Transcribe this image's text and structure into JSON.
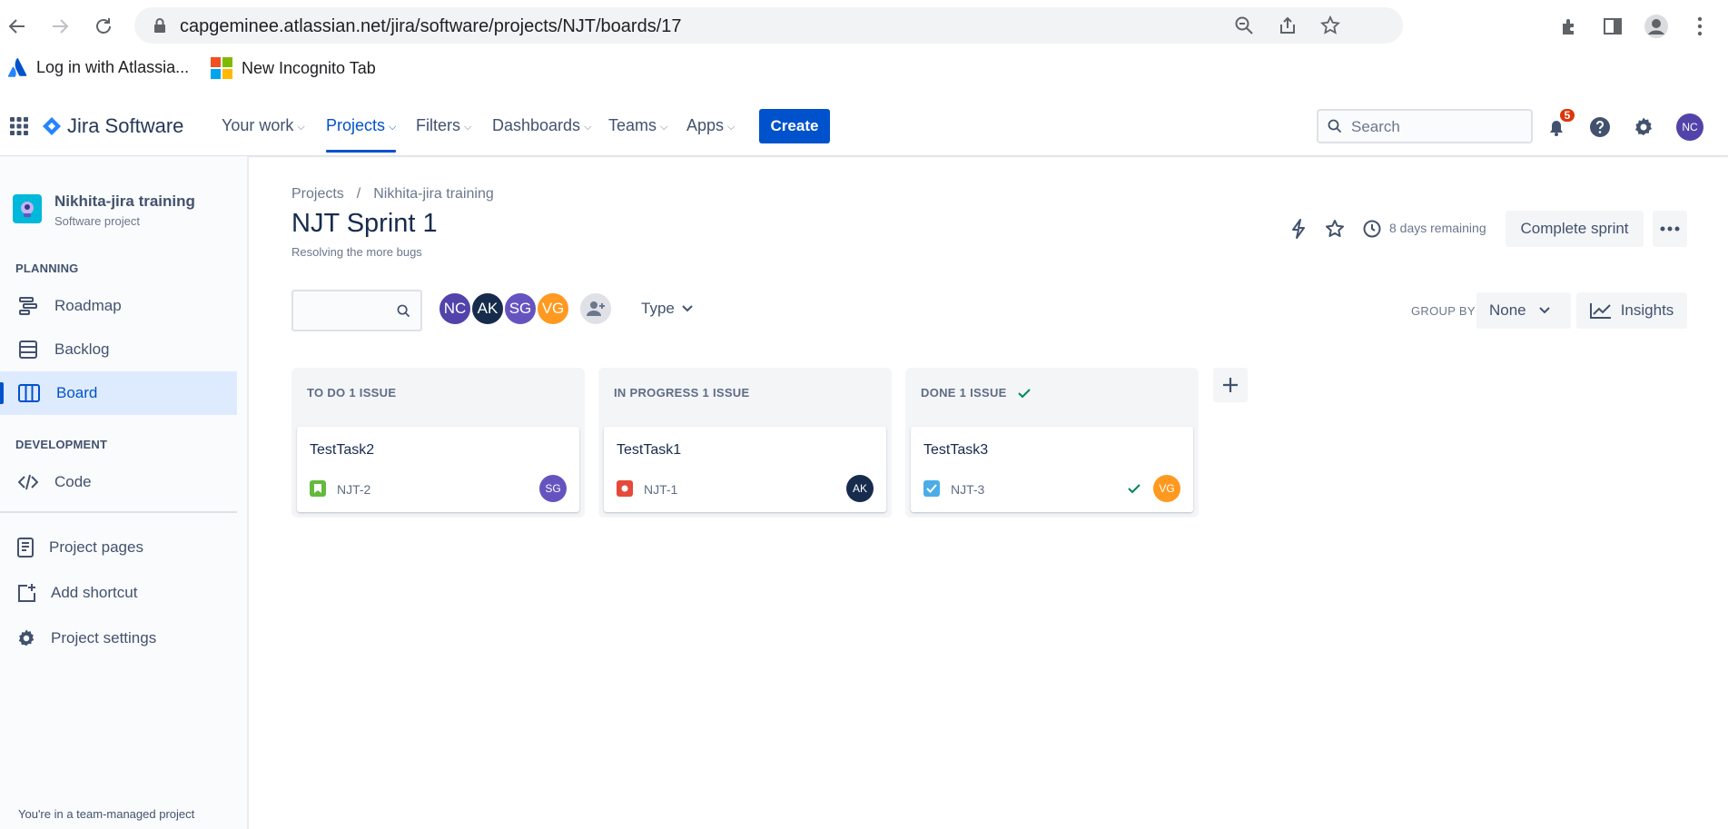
{
  "browser": {
    "url": "capgeminee.atlassian.net/jira/software/projects/NJT/boards/17",
    "bookmarks": [
      {
        "label": "Log in with Atlassia..."
      },
      {
        "label": "New Incognito Tab"
      }
    ]
  },
  "topnav": {
    "product": "Jira Software",
    "items": [
      {
        "label": "Your work"
      },
      {
        "label": "Projects"
      },
      {
        "label": "Filters"
      },
      {
        "label": "Dashboards"
      },
      {
        "label": "Teams"
      },
      {
        "label": "Apps"
      }
    ],
    "create_label": "Create",
    "search_placeholder": "Search",
    "notification_count": "5",
    "user_initials": "NC",
    "colors": {
      "brand": "#0052cc",
      "notification": "#de350b",
      "user_avatar": "#5243aa"
    }
  },
  "sidebar": {
    "project_name": "Nikhita-jira training",
    "project_type": "Software project",
    "planning_heading": "PLANNING",
    "planning_items": [
      {
        "label": "Roadmap",
        "icon": "roadmap-icon"
      },
      {
        "label": "Backlog",
        "icon": "backlog-icon"
      },
      {
        "label": "Board",
        "icon": "board-icon",
        "active": true
      }
    ],
    "development_heading": "DEVELOPMENT",
    "development_items": [
      {
        "label": "Code",
        "icon": "code-icon"
      }
    ],
    "other_items": [
      {
        "label": "Project pages",
        "icon": "page-icon"
      },
      {
        "label": "Add shortcut",
        "icon": "add-shortcut-icon"
      },
      {
        "label": "Project settings",
        "icon": "gear-icon"
      }
    ],
    "footer": "You're in a team-managed project"
  },
  "main": {
    "breadcrumb": [
      {
        "label": "Projects"
      },
      {
        "label": "/"
      },
      {
        "label": "Nikhita-jira training"
      }
    ],
    "sprint_title": "NJT Sprint 1",
    "sprint_goal": "Resolving the more bugs",
    "days_remaining": "8 days remaining",
    "complete_sprint_label": "Complete sprint",
    "assignee_avatars": [
      {
        "initials": "NC",
        "color": "#5243aa"
      },
      {
        "initials": "AK",
        "color": "#172b4d"
      },
      {
        "initials": "SG",
        "color": "#6554c0"
      },
      {
        "initials": "VG",
        "color": "#ff991f"
      }
    ],
    "type_filter_label": "Type",
    "group_by_label": "GROUP BY",
    "group_by_value": "None",
    "insights_label": "Insights"
  },
  "board": {
    "columns": [
      {
        "heading": "TO DO 1 ISSUE",
        "done_check": false,
        "card": {
          "title": "TestTask2",
          "key": "NJT-2",
          "type": "story-icon",
          "type_color": "#63ba3c",
          "assignee": "SG",
          "assignee_color": "#6554c0",
          "resolved": false
        }
      },
      {
        "heading": "IN PROGRESS 1 ISSUE",
        "done_check": false,
        "card": {
          "title": "TestTask1",
          "key": "NJT-1",
          "type": "bug-icon",
          "type_color": "#e5493a",
          "assignee": "AK",
          "assignee_color": "#172b4d",
          "resolved": false
        }
      },
      {
        "heading": "DONE 1 ISSUE",
        "done_check": true,
        "card": {
          "title": "TestTask3",
          "key": "NJT-3",
          "type": "task-icon",
          "type_color": "#4bade8",
          "assignee": "VG",
          "assignee_color": "#ff991f",
          "resolved": true
        }
      }
    ]
  }
}
